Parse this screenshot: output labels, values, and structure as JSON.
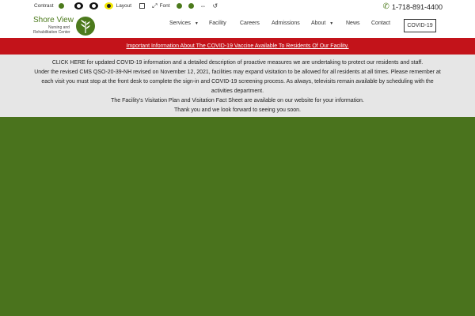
{
  "toolbar": {
    "contrast_label": "Contrast",
    "layout_label": "Layout",
    "font_label": "Font",
    "phone": "1-718-891-4400"
  },
  "logo": {
    "name": "Shore View",
    "sub_line1": "Nursing and",
    "sub_line2": "Rehabilitation Center"
  },
  "nav": {
    "items": [
      {
        "label": "Services"
      },
      {
        "label": "Facility"
      },
      {
        "label": "Careers"
      },
      {
        "label": "Admissions"
      },
      {
        "label": "About"
      },
      {
        "label": "News"
      },
      {
        "label": "Contact"
      }
    ],
    "covid_button": "COVID-19"
  },
  "banner": {
    "link_text": "Important Information About The COVID-19 Vaccine Available To Residents Of Our Facility."
  },
  "notice": {
    "line1": "CLICK HERE for updated COVID-19 information and a detailed description of proactive measures we are undertaking to protect our residents and staff.",
    "line2": "Under the revised CMS QSO-20-39-NH revised on November 12, 2021, facilities may expand visitation to be allowed for all residents at all times. Please remember at each visit you must stop at the front desk to complete the sign-in and COVID-19 screening process. As always, televisits remain available by scheduling with the activities department.",
    "line3": "The Facility's Visitation Plan and Visitation Fact Sheet are available on our website for your information.",
    "line4": "Thank you and we look forward to seeing you soon."
  },
  "colors": {
    "brand_green": "#4c7a1c",
    "banner_red": "#c3131a",
    "hero_green": "#4a731d",
    "notice_gray": "#e6e6e6"
  }
}
